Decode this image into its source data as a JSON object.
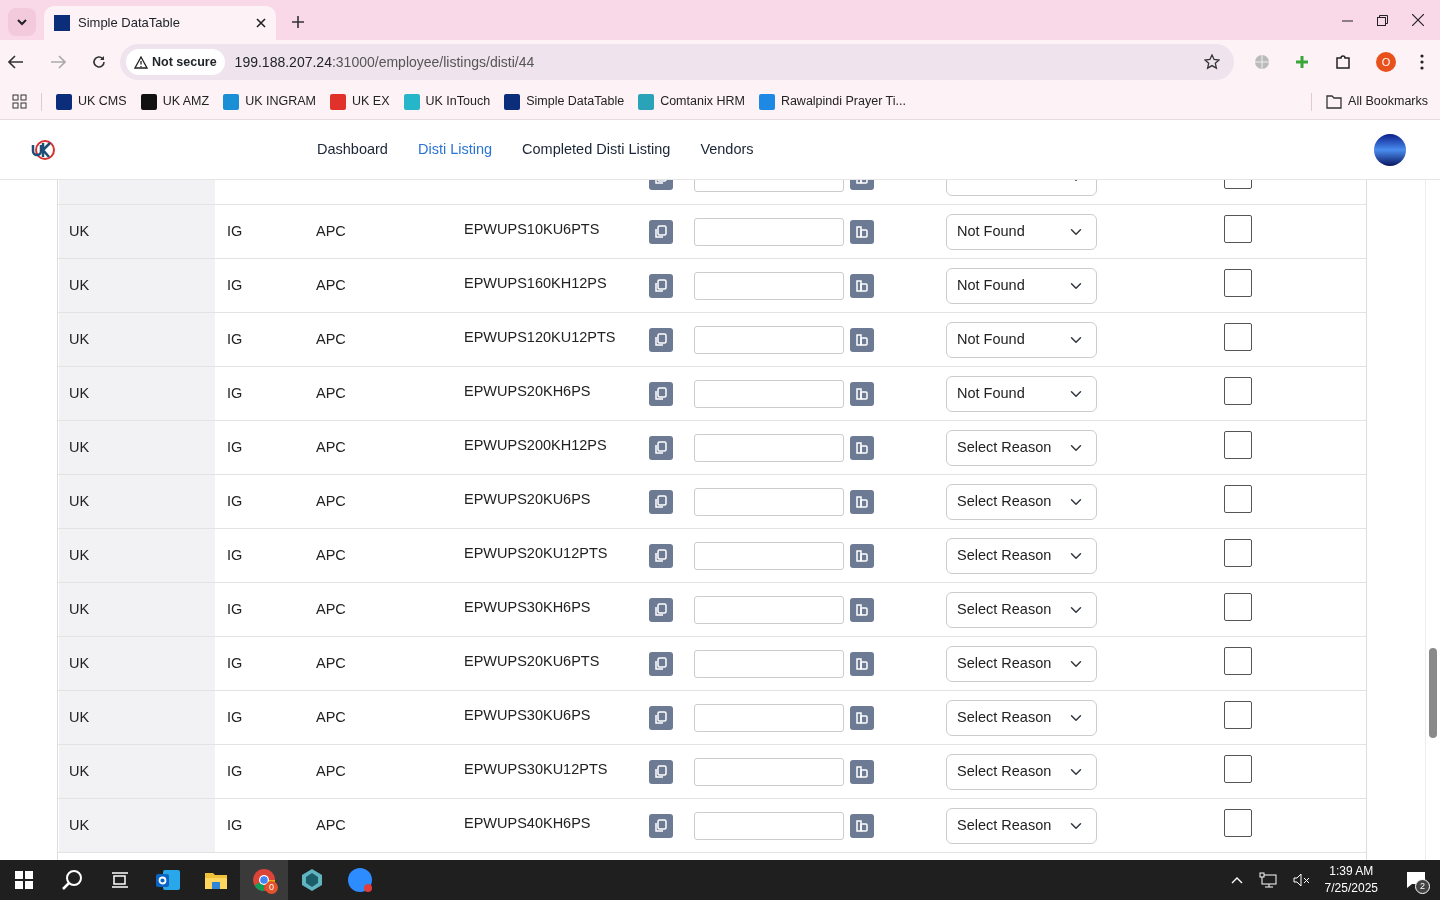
{
  "browser": {
    "tab_title": "Simple DataTable",
    "security": "Not secure",
    "url_host": "199.188.207.24",
    "url_path": ":31000/employee/listings/disti/44",
    "profile_initial": "O",
    "bookmarks": [
      {
        "label": "UK CMS",
        "color": "#0b2d7a"
      },
      {
        "label": "UK AMZ",
        "color": "#111111"
      },
      {
        "label": "UK INGRAM",
        "color": "#1a8fd6"
      },
      {
        "label": "UK EX",
        "color": "#e0322b"
      },
      {
        "label": "UK InTouch",
        "color": "#25b7c9"
      },
      {
        "label": "Simple DataTable",
        "color": "#0b2d7a"
      },
      {
        "label": "Comtanix HRM",
        "color": "#2aa3b8"
      },
      {
        "label": "Rawalpindi Prayer Ti...",
        "color": "#1e88e5"
      }
    ],
    "all_bookmarks": "All Bookmarks"
  },
  "nav": {
    "items": [
      {
        "label": "Dashboard",
        "selected": false
      },
      {
        "label": "Disti Listing",
        "selected": true
      },
      {
        "label": "Completed Disti Listing",
        "selected": false
      },
      {
        "label": "Vendors",
        "selected": false
      }
    ]
  },
  "rows": [
    {
      "kind": "clipped",
      "checked": false
    },
    {
      "kind": "full",
      "country": "UK",
      "distributor": "IG",
      "brand": "APC",
      "sku": "EPWUPS10KU6PTS",
      "reason": "Not Found",
      "checked": false
    },
    {
      "kind": "full",
      "country": "UK",
      "distributor": "IG",
      "brand": "APC",
      "sku": "EPWUPS160KH12PS",
      "reason": "Not Found",
      "checked": false
    },
    {
      "kind": "full",
      "country": "UK",
      "distributor": "IG",
      "brand": "APC",
      "sku": "EPWUPS120KU12PTS",
      "reason": "Not Found",
      "checked": false
    },
    {
      "kind": "full",
      "country": "UK",
      "distributor": "IG",
      "brand": "APC",
      "sku": "EPWUPS20KH6PS",
      "reason": "Not Found",
      "checked": false
    },
    {
      "kind": "full",
      "country": "UK",
      "distributor": "IG",
      "brand": "APC",
      "sku": "EPWUPS200KH12PS",
      "reason": "Select Reason",
      "checked": false
    },
    {
      "kind": "full",
      "country": "UK",
      "distributor": "IG",
      "brand": "APC",
      "sku": "EPWUPS20KU6PS",
      "reason": "Select Reason",
      "checked": false
    },
    {
      "kind": "full",
      "country": "UK",
      "distributor": "IG",
      "brand": "APC",
      "sku": "EPWUPS20KU12PTS",
      "reason": "Select Reason",
      "checked": false
    },
    {
      "kind": "full",
      "country": "UK",
      "distributor": "IG",
      "brand": "APC",
      "sku": "EPWUPS30KH6PS",
      "reason": "Select Reason",
      "checked": false
    },
    {
      "kind": "full",
      "country": "UK",
      "distributor": "IG",
      "brand": "APC",
      "sku": "EPWUPS20KU6PTS",
      "reason": "Select Reason",
      "checked": false
    },
    {
      "kind": "full",
      "country": "UK",
      "distributor": "IG",
      "brand": "APC",
      "sku": "EPWUPS30KU6PS",
      "reason": "Select Reason",
      "checked": false
    },
    {
      "kind": "full",
      "country": "UK",
      "distributor": "IG",
      "brand": "APC",
      "sku": "EPWUPS30KU12PTS",
      "reason": "Select Reason",
      "checked": false
    },
    {
      "kind": "full",
      "country": "UK",
      "distributor": "IG",
      "brand": "APC",
      "sku": "EPWUPS40KH6PS",
      "reason": "Select Reason",
      "checked": false
    }
  ],
  "taskbar": {
    "chrome_badge": "0",
    "time": "1:39 AM",
    "date": "7/25/2025",
    "notifications": "2"
  }
}
